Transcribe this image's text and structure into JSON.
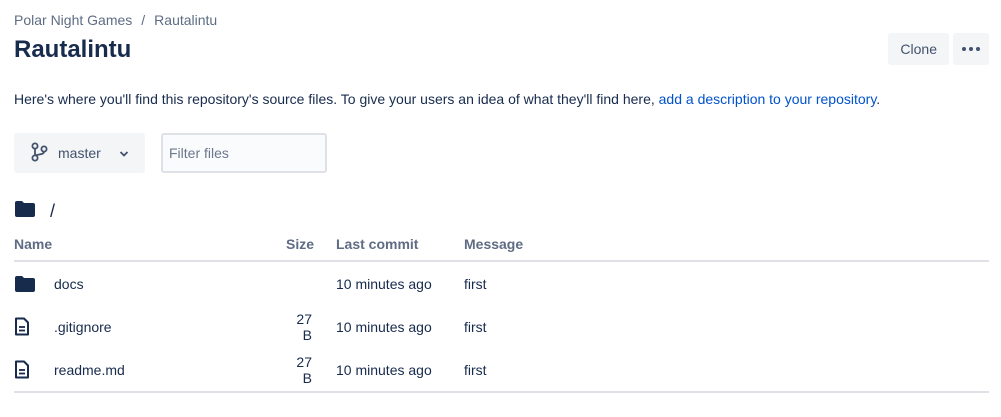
{
  "breadcrumb": {
    "project": "Polar Night Games",
    "separator": "/",
    "repo": "Rautalintu"
  },
  "page_title": "Rautalintu",
  "actions": {
    "clone_label": "Clone"
  },
  "intro": {
    "text": "Here's where you'll find this repository's source files. To give your users an idea of what they'll find here, ",
    "link": "add a description to your repository",
    "suffix": "."
  },
  "branch": {
    "name": "master"
  },
  "filter": {
    "placeholder": "Filter files"
  },
  "path": "/",
  "table": {
    "headers": {
      "name": "Name",
      "size": "Size",
      "last_commit": "Last commit",
      "message": "Message"
    },
    "rows": [
      {
        "icon": "folder-icon",
        "name": "docs",
        "size": "",
        "last_commit": "10 minutes ago",
        "message": "first"
      },
      {
        "icon": "file-icon",
        "name": ".gitignore",
        "size": "27 B",
        "last_commit": "10 minutes ago",
        "message": "first"
      },
      {
        "icon": "file-icon",
        "name": "readme.md",
        "size": "27 B",
        "last_commit": "10 minutes ago",
        "message": "first"
      }
    ]
  },
  "colors": {
    "text": "#172b4d",
    "subtle": "#5e6c84",
    "link": "#0052cc",
    "button_bg": "#f4f5f7",
    "border": "#dfe1e6"
  }
}
